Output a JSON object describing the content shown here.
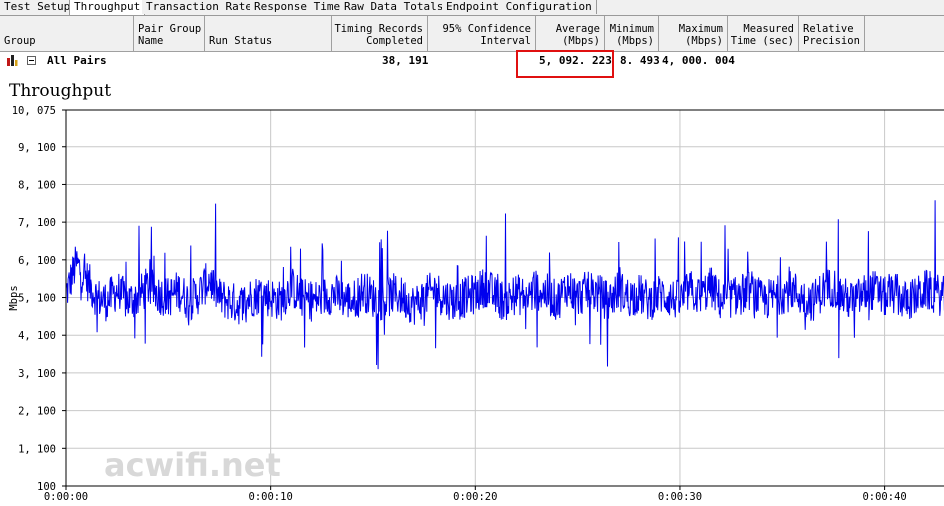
{
  "tabs": [
    "Test Setup",
    "Throughput",
    "Transaction Rate",
    "Response Time",
    "Raw Data Totals",
    "Endpoint Configuration"
  ],
  "active_tab": "Throughput",
  "columns": {
    "group": "Group",
    "pair_group_name": "Pair Group\nName",
    "run_status": "Run Status",
    "timing_records": "Timing Records\nCompleted",
    "confidence": "95% Confidence\nInterval",
    "average": "Average\n(Mbps)",
    "minimum": "Minimum\n(Mbps)",
    "maximum": "Maximum\n(Mbps)",
    "measured_time": "Measured\nTime (sec)",
    "relative_precision": "Relative\nPrecision"
  },
  "row": {
    "group": "All Pairs",
    "timing_records": "38, 191",
    "average": "5, 092. 223",
    "minimum": "8. 493",
    "maximum": "4, 000. 004"
  },
  "colors": {
    "series": "#0000ee",
    "highlight": "#e01010"
  },
  "chart_data": {
    "type": "line",
    "title": "Throughput",
    "ylabel": "Mbps",
    "xlabel": "",
    "ylim": [
      100,
      10075
    ],
    "xlim_seconds": [
      0,
      43
    ],
    "y_ticks": [
      "10, 075",
      "9, 100",
      "8, 100",
      "7, 100",
      "6, 100",
      "5, 100",
      "4, 100",
      "3, 100",
      "2, 100",
      "1, 100",
      "100"
    ],
    "y_tick_values": [
      10075,
      9100,
      8100,
      7100,
      6100,
      5100,
      4100,
      3100,
      2100,
      1100,
      100
    ],
    "x_ticks": [
      "0:00:00",
      "0:00:10",
      "0:00:20",
      "0:00:30",
      "0:00:40"
    ],
    "x_tick_values": [
      0,
      10,
      20,
      30,
      40
    ],
    "grid": true,
    "series": [
      {
        "x": [
          0,
          0.5,
          1,
          1.5,
          2,
          2.5,
          3,
          3.5,
          4,
          4.5,
          5,
          5.5,
          6,
          6.5,
          7,
          7.5,
          8,
          8.5,
          9,
          9.5,
          10,
          10.5,
          11,
          11.5,
          12,
          12.5,
          13,
          13.5,
          14,
          14.5,
          15,
          15.5,
          16,
          16.5,
          17,
          17.5,
          18,
          18.5,
          19,
          19.5,
          20,
          20.5,
          21,
          21.5,
          22,
          22.5,
          23,
          23.5,
          24,
          24.5,
          25,
          25.5,
          26,
          26.5,
          27,
          27.5,
          28,
          28.5,
          29,
          29.5,
          30,
          30.5,
          31,
          31.5,
          32,
          32.5,
          33,
          33.5,
          34,
          34.5,
          35,
          35.5,
          36,
          36.5,
          37,
          37.5,
          38,
          38.5,
          39,
          39.5,
          40,
          40.5,
          41,
          41.5,
          42,
          42.5,
          43
        ],
        "y": [
          5200,
          6000,
          5600,
          5100,
          5000,
          5300,
          5000,
          5100,
          5400,
          5200,
          5100,
          5300,
          5000,
          5200,
          5600,
          5100,
          5000,
          4900,
          5100,
          5200,
          5100,
          5000,
          5400,
          5100,
          5000,
          5100,
          5200,
          5100,
          5000,
          5300,
          5100,
          5000,
          5200,
          5100,
          4900,
          5100,
          5300,
          5100,
          5000,
          5100,
          5200,
          5400,
          5100,
          5000,
          5200,
          5100,
          5300,
          5200,
          5000,
          5400,
          5100,
          5300,
          5200,
          5000,
          5300,
          5100,
          5200,
          5000,
          5200,
          5100,
          5000,
          5300,
          5100,
          5400,
          5000,
          5100,
          5200,
          5300,
          5000,
          5100,
          5200,
          5300,
          5100,
          5000,
          5300,
          5400,
          5100,
          5000,
          5200,
          5300,
          5100,
          5200,
          5000,
          5100,
          5300,
          5200,
          5100
        ]
      }
    ]
  },
  "watermark": "acwifi.net"
}
